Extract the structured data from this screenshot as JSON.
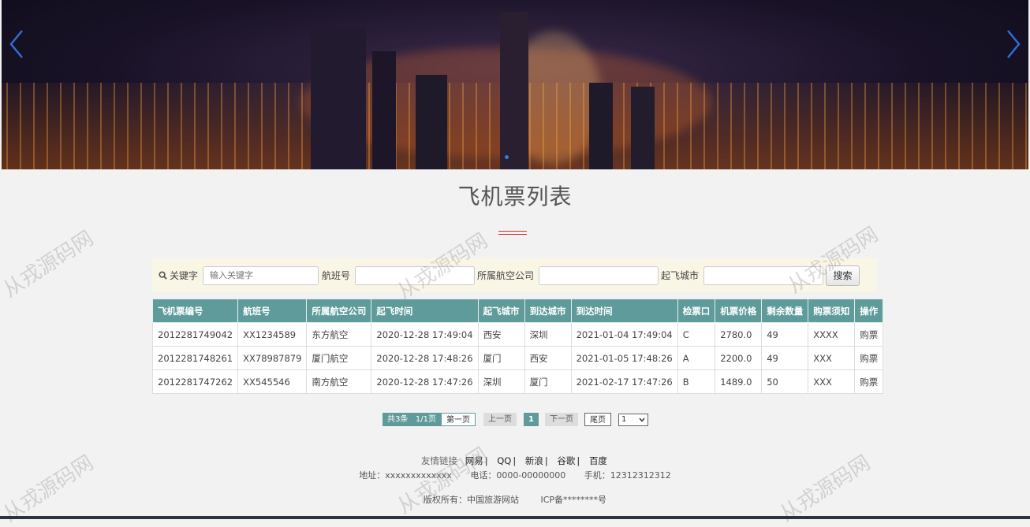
{
  "page_title": "飞机票列表",
  "search": {
    "keyword_label": "关键字",
    "keyword_placeholder": "输入关键字",
    "flight_no_label": "航班号",
    "airline_label": "所属航空公司",
    "departure_city_label": "起飞城市",
    "search_button": "搜索"
  },
  "table": {
    "headers": [
      "飞机票编号",
      "航班号",
      "所属航空公司",
      "起飞时间",
      "起飞城市",
      "到达城市",
      "到达时间",
      "检票口",
      "机票价格",
      "剩余数量",
      "购票须知",
      "操作"
    ],
    "rows": [
      [
        "2012281749042",
        "XX1234589",
        "东方航空",
        "2020-12-28 17:49:04",
        "西安",
        "深圳",
        "2021-01-04 17:49:04",
        "C",
        "2780.0",
        "49",
        "XXXX",
        "购票"
      ],
      [
        "2012281748261",
        "XX78987879",
        "厦门航空",
        "2020-12-28 17:48:26",
        "厦门",
        "西安",
        "2021-01-05 17:48:26",
        "A",
        "2200.0",
        "49",
        "XXX",
        "购票"
      ],
      [
        "2012281747262",
        "XX545546",
        "南方航空",
        "2020-12-28 17:47:26",
        "深圳",
        "厦门",
        "2021-02-17 17:47:26",
        "B",
        "1489.0",
        "50",
        "XXX",
        "购票"
      ]
    ]
  },
  "pagination": {
    "total": "共3条",
    "pages": "1/1页",
    "first": "第一页",
    "prev": "上一页",
    "current": "1",
    "next": "下一页",
    "last": "尾页",
    "select_value": "1"
  },
  "footer": {
    "links_label": "友情链接",
    "links": [
      "网易",
      "QQ",
      "新浪",
      "谷歌",
      "百度"
    ],
    "address": "地址：xxxxxxxxxxxxx",
    "phone": "电话：0000-00000000",
    "mobile": "手机：12312312312",
    "copyright": "版权所有：中国旅游网站",
    "icp": "ICP备********号"
  },
  "watermark": "从戎源码网",
  "colors": {
    "table_header": "#5f9b9b",
    "search_bg": "#faf6e6",
    "arrow": "#2d6fd6",
    "title_deco": "#cc3333"
  },
  "icons": {
    "search": "magnifier-icon",
    "banner_prev": "chevron-left-icon",
    "banner_next": "chevron-right-icon"
  }
}
